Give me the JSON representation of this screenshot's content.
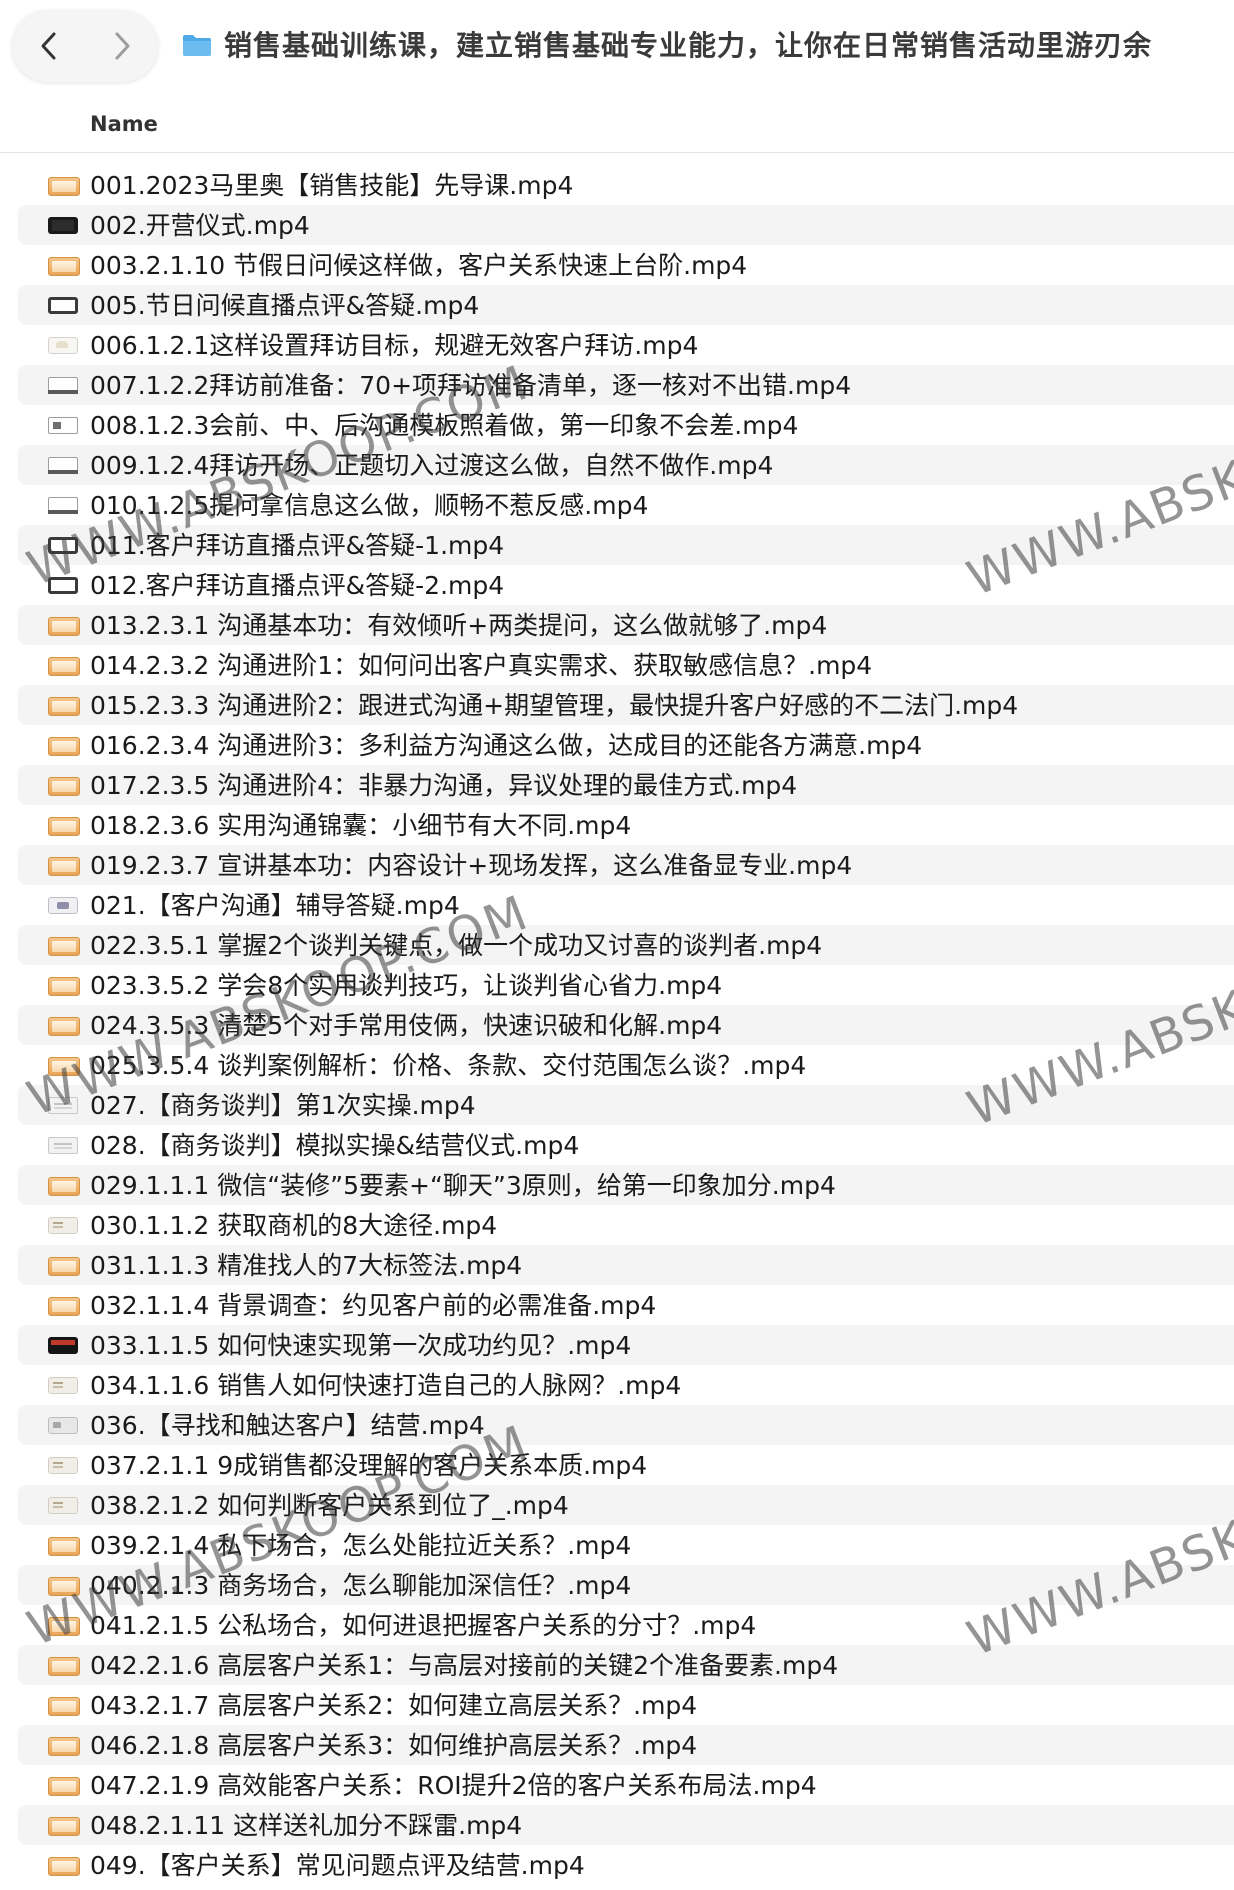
{
  "window": {
    "title": "销售基础训练课，建立销售基础专业能力，让你在日常销售活动里游刃余"
  },
  "column_header": {
    "name": "Name"
  },
  "files": [
    {
      "name": "001.2023马里奥【销售技能】先导课.mp4",
      "icon": "video-icon"
    },
    {
      "name": "002.开营仪式.mp4",
      "icon": "dark-video-icon"
    },
    {
      "name": "003.2.1.10 节假日问候这样做，客户关系快速上台阶.mp4",
      "icon": "video-icon"
    },
    {
      "name": "005.节日问候直播点评&答疑.mp4",
      "icon": "framed-video-icon"
    },
    {
      "name": "006.1.2.1这样设置拜访目标，规避无效客户拜访.mp4",
      "icon": "white-video-icon"
    },
    {
      "name": "007.1.2.2拜访前准备：70+项拜访准备清单，逐一核对不出错.mp4",
      "icon": "paper-video-icon"
    },
    {
      "name": "008.1.2.3会前、中、后沟通模板照着做，第一印象不会差.mp4",
      "icon": "slide-video-icon"
    },
    {
      "name": "009.1.2.4拜访开场、正题切入过渡这么做，自然不做作.mp4",
      "icon": "paper-video-icon"
    },
    {
      "name": "010.1.2.5提问拿信息这么做，顺畅不惹反感.mp4",
      "icon": "paper-video-icon"
    },
    {
      "name": "011.客户拜访直播点评&答疑-1.mp4",
      "icon": "framed-video-icon"
    },
    {
      "name": "012.客户拜访直播点评&答疑-2.mp4",
      "icon": "framed-video-icon"
    },
    {
      "name": "013.2.3.1 沟通基本功：有效倾听+两类提问，这么做就够了.mp4",
      "icon": "video-icon"
    },
    {
      "name": "014.2.3.2 沟通进阶1：如何问出客户真实需求、获取敏感信息？.mp4",
      "icon": "video-icon"
    },
    {
      "name": "015.2.3.3 沟通进阶2：跟进式沟通+期望管理，最快提升客户好感的不二法门.mp4",
      "icon": "video-icon"
    },
    {
      "name": "016.2.3.4 沟通进阶3：多利益方沟通这么做，达成目的还能各方满意.mp4",
      "icon": "video-icon"
    },
    {
      "name": "017.2.3.5 沟通进阶4：非暴力沟通，异议处理的最佳方式.mp4",
      "icon": "video-icon"
    },
    {
      "name": "018.2.3.6 实用沟通锦囊：小细节有大不同.mp4",
      "icon": "video-icon"
    },
    {
      "name": "019.2.3.7 宣讲基本功：内容设计+现场发挥，这么准备显专业.mp4",
      "icon": "video-icon"
    },
    {
      "name": "021.【客户沟通】辅导答疑.mp4",
      "icon": "photo-video-icon"
    },
    {
      "name": "022.3.5.1 掌握2个谈判关键点，做一个成功又讨喜的谈判者.mp4",
      "icon": "video-icon"
    },
    {
      "name": "023.3.5.2 学会8个实用谈判技巧，让谈判省心省力.mp4",
      "icon": "video-icon"
    },
    {
      "name": "024.3.5.3 清楚5个对手常用伎俩，快速识破和化解.mp4",
      "icon": "video-icon"
    },
    {
      "name": "025.3.5.4 谈判案例解析：价格、条款、交付范围怎么谈？.mp4",
      "icon": "video-icon"
    },
    {
      "name": "027.【商务谈判】第1次实操.mp4",
      "icon": "doc-video-icon"
    },
    {
      "name": "028.【商务谈判】模拟实操&结营仪式.mp4",
      "icon": "doc-video-icon"
    },
    {
      "name": "029.1.1.1 微信“装修”5要素+“聊天”3原则，给第一印象加分.mp4",
      "icon": "video-icon"
    },
    {
      "name": "030.1.1.2 获取商机的8大途径.mp4",
      "icon": "pale-video-icon"
    },
    {
      "name": "031.1.1.3 精准找人的7大标签法.mp4",
      "icon": "video-icon"
    },
    {
      "name": "032.1.1.4 背景调查：约见客户前的必需准备.mp4",
      "icon": "video-icon"
    },
    {
      "name": "033.1.1.5 如何快速实现第一次成功约见？.mp4",
      "icon": "screen-video-icon"
    },
    {
      "name": "034.1.1.6 销售人如何快速打造自己的人脉网？.mp4",
      "icon": "pale-video-icon"
    },
    {
      "name": "036.【寻找和触达客户】结营.mp4",
      "icon": "light-video-icon"
    },
    {
      "name": "037.2.1.1 9成销售都没理解的客户关系本质.mp4",
      "icon": "pale-video-icon"
    },
    {
      "name": "038.2.1.2 如何判断客户关系到位了_.mp4",
      "icon": "pale-video-icon"
    },
    {
      "name": "039.2.1.4 私下场合，怎么处能拉近关系？.mp4",
      "icon": "video-icon"
    },
    {
      "name": "040.2.1.3 商务场合，怎么聊能加深信任？.mp4",
      "icon": "video-icon"
    },
    {
      "name": "041.2.1.5 公私场合，如何进退把握客户关系的分寸？.mp4",
      "icon": "video-icon"
    },
    {
      "name": "042.2.1.6 高层客户关系1：与高层对接前的关键2个准备要素.mp4",
      "icon": "video-icon"
    },
    {
      "name": "043.2.1.7 高层客户关系2：如何建立高层关系？.mp4",
      "icon": "video-icon"
    },
    {
      "name": "046.2.1.8 高层客户关系3：如何维护高层关系？.mp4",
      "icon": "video-icon"
    },
    {
      "name": "047.2.1.9 高效能客户关系：ROI提升2倍的客户关系布局法.mp4",
      "icon": "video-icon"
    },
    {
      "name": "048.2.1.11 这样送礼加分不踩雷.mp4",
      "icon": "video-icon"
    },
    {
      "name": "049.【客户关系】常见问题点评及结营.mp4",
      "icon": "video-icon"
    }
  ],
  "watermarks": [
    "WWW.ABSKOOP.COM",
    "WWW.ABSKOOP.COM",
    "WWW.ABSKOOP.COM",
    "WWW.ABSKOO",
    "WWW.ABSKOO",
    "WWW.ABSKOO"
  ],
  "colors": {
    "folder": "#4fa9e6",
    "alt_row": "#f4f4f4",
    "header_border": "#e3e3e3"
  }
}
